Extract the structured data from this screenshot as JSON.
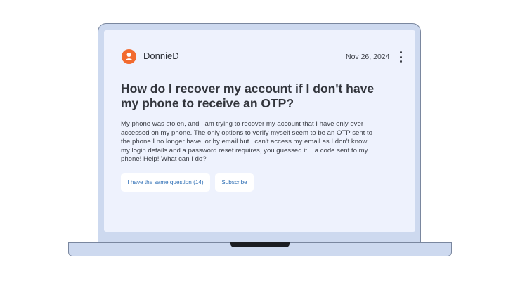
{
  "post": {
    "author": "DonnieD",
    "date": "Nov 26, 2024",
    "title": "How do I recover my account if I don't have my phone to receive an OTP?",
    "body": "My phone was stolen, and I am trying to recover my account that I have only ever accessed on my phone. The only options to verify myself seem to be an OTP sent to the phone I no longer have, or by email but I can't access my email as I don't know my login details and a password reset requires, you guessed it... a code sent to my phone! Help! What can I do?"
  },
  "actions": {
    "same_question_label": "I have the same question (14)",
    "subscribe_label": "Subscribe"
  },
  "icons": {
    "avatar": "user-icon",
    "menu": "more-vertical-icon"
  },
  "colors": {
    "avatar": "#f26a2e",
    "button_text": "#2f6fb5",
    "screen_bg": "#eef2fd",
    "laptop_body": "#cdd9ef"
  }
}
